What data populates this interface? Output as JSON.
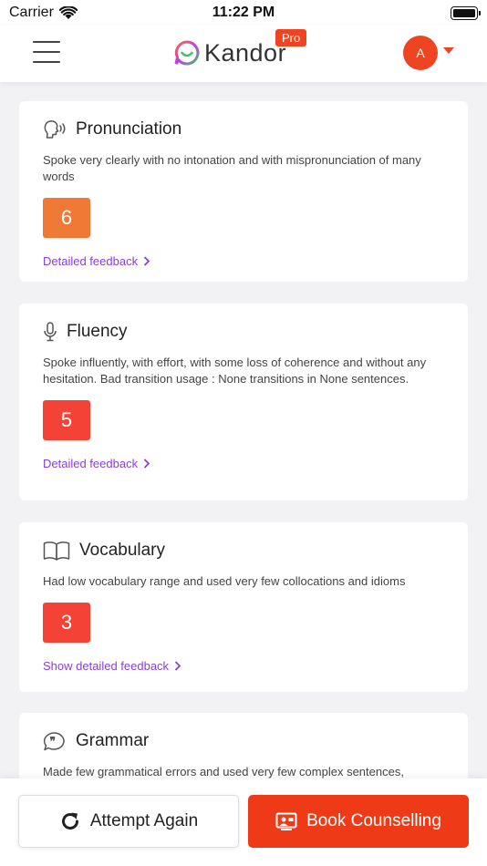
{
  "status": {
    "carrier": "Carrier",
    "time": "11:22 PM"
  },
  "header": {
    "logo_text": "Kandor",
    "pro_badge": "Pro",
    "avatar_initial": "A"
  },
  "cards": [
    {
      "title": "Pronunciation",
      "icon": "speaking-head-icon",
      "description": "Spoke very clearly with no intonation and with mispronunciation of many words",
      "score": "6",
      "score_color": "#f07a35",
      "link": "Detailed feedback"
    },
    {
      "title": "Fluency",
      "icon": "microphone-icon",
      "description": "Spoke influently, with effort, with some loss of coherence and without any hesitation. Bad transition usage : None transitions in None sentences.",
      "score": "5",
      "score_color": "#f44336",
      "link": "Detailed feedback"
    },
    {
      "title": "Vocabulary",
      "icon": "book-icon",
      "description": "Had low vocabulary range and used very few collocations and idioms",
      "score": "3",
      "score_color": "#f44336",
      "link": "Show detailed feedback"
    },
    {
      "title": "Grammar",
      "icon": "quote-bubble-icon",
      "description": "Made few grammatical errors and used very few complex sentences,"
    }
  ],
  "actions": {
    "attempt_again": "Attempt Again",
    "book_counselling": "Book Counselling"
  },
  "colors": {
    "accent": "#ee3a17",
    "link": "#8a3fd6"
  }
}
